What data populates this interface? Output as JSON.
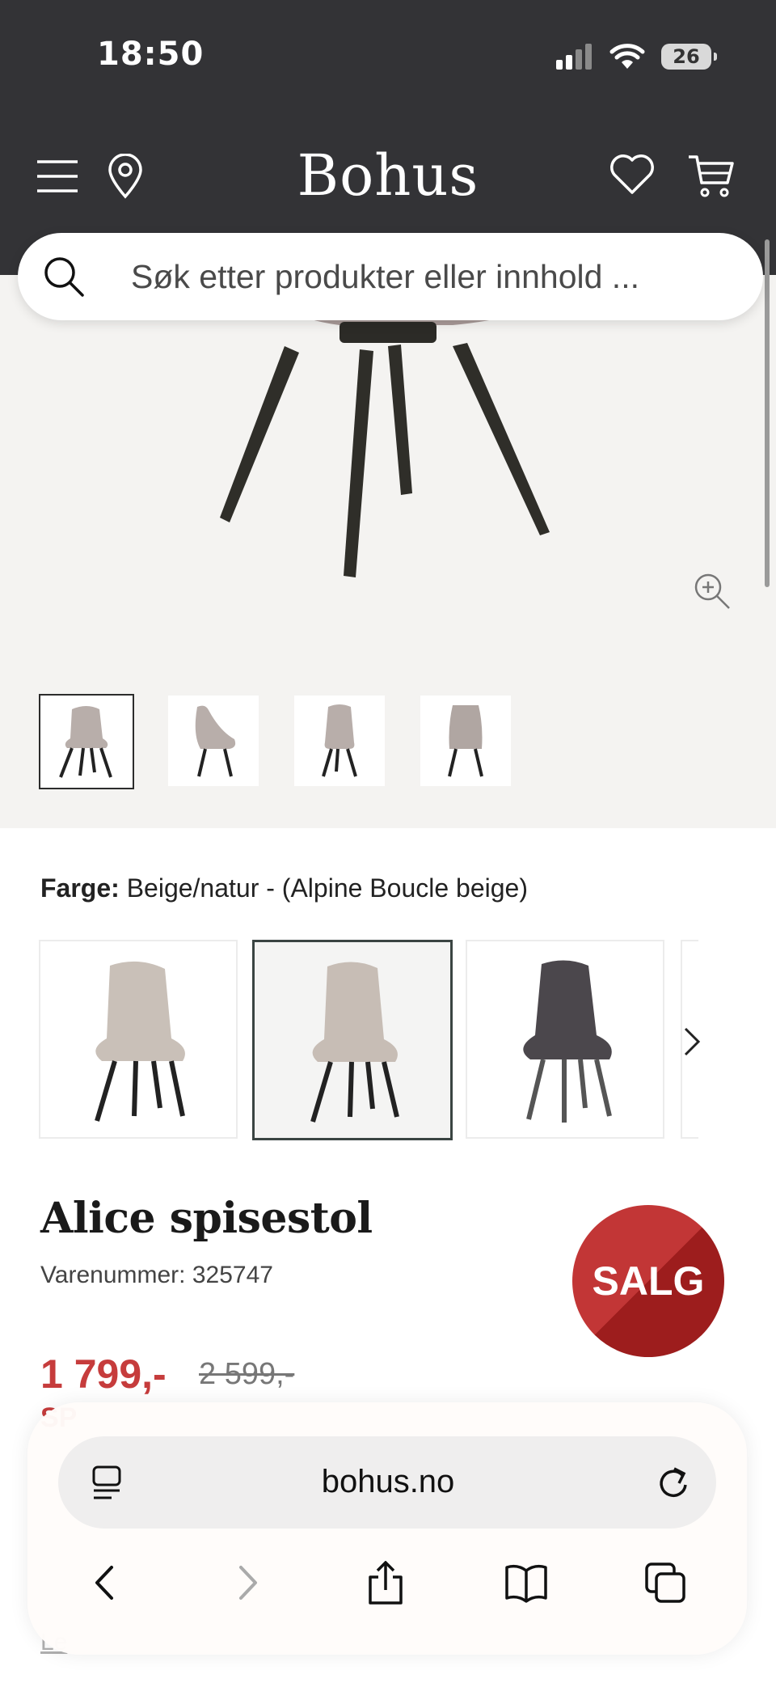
{
  "status_bar": {
    "time": "18:50",
    "battery": "26"
  },
  "header": {
    "logo": "Bohus"
  },
  "search": {
    "placeholder": "Søk etter produkter eller innhold ..."
  },
  "product": {
    "color_label": "Farge:",
    "color_value": "Beige/natur - (Alpine Boucle beige)",
    "title": "Alice spisestol",
    "sku": "Varenummer: 325747",
    "badge": "SALG",
    "price": "1 799,-",
    "old_price": "2 599,-",
    "price_sub": "SP",
    "read_more": "Le"
  },
  "thumbnails": [
    {
      "view": "front",
      "selected": true
    },
    {
      "view": "side",
      "selected": false
    },
    {
      "view": "back-angled",
      "selected": false
    },
    {
      "view": "back",
      "selected": false
    }
  ],
  "swatches": [
    {
      "color": "#c9c0b8",
      "selected": false
    },
    {
      "color": "#c7bdb5",
      "selected": true
    },
    {
      "color": "#4b474c",
      "selected": false
    }
  ],
  "browser": {
    "url": "bohus.no"
  },
  "colors": {
    "header_bg": "#333336",
    "sale_red": "#c63c3c",
    "hero_bg": "#f4f3f1"
  }
}
